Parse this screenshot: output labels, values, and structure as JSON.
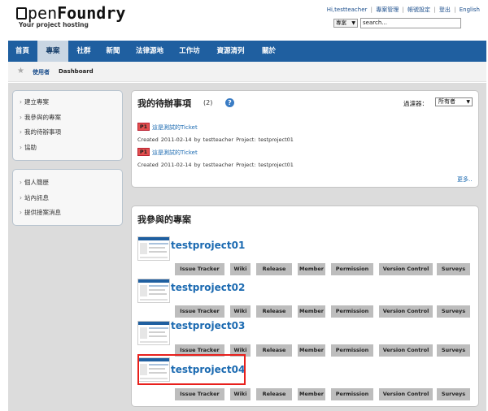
{
  "header": {
    "logo": {
      "open": "pen",
      "foundry": "Foundry"
    },
    "tagline": "Your project hosting",
    "toplinks": [
      "Hi,testteacher",
      "專案管理",
      "帳號設定",
      "登出",
      "English"
    ],
    "lang_select": "專案",
    "search_value": "search..."
  },
  "nav": {
    "items": [
      "首頁",
      "專案",
      "社群",
      "新聞",
      "法律源地",
      "工作坊",
      "資源清列",
      "關於"
    ],
    "active_index": 1
  },
  "breadcrumb": {
    "user": "使用者",
    "current": "Dashboard"
  },
  "sidebar": {
    "group1": [
      "建立專案",
      "我參與的專案",
      "我的待辦事項",
      "協助"
    ],
    "group2": [
      "個人簡歷",
      "站內訊息",
      "提供接案消息"
    ]
  },
  "todo": {
    "title": "我的待辦事項",
    "count": "(2)",
    "filter_label": "過濾器：",
    "filter_value": "所有者",
    "tickets": [
      {
        "badge": "P1",
        "title": "這是測試的Ticket",
        "meta": "Created 2011-02-14  by testteacher  Project:  testproject01"
      },
      {
        "badge": "P1",
        "title": "這是測試的Ticket",
        "meta": "Created 2011-02-14  by testteacher  Project:  testproject01"
      }
    ],
    "more": "更多.."
  },
  "projects": {
    "title": "我參與的專案",
    "buttons": [
      "Issue Tracker",
      "Wiki",
      "Release",
      "Member",
      "Permission",
      "Version Control",
      "Surveys"
    ],
    "items": [
      {
        "name": "testproject01"
      },
      {
        "name": "testproject02"
      },
      {
        "name": "testproject03"
      },
      {
        "name": "testproject04"
      }
    ]
  },
  "colors": {
    "nav_bg": "#1f5fa0",
    "link": "#1b6ab1",
    "badge_p1": "#e3504f",
    "highlight": "#e8201c"
  }
}
